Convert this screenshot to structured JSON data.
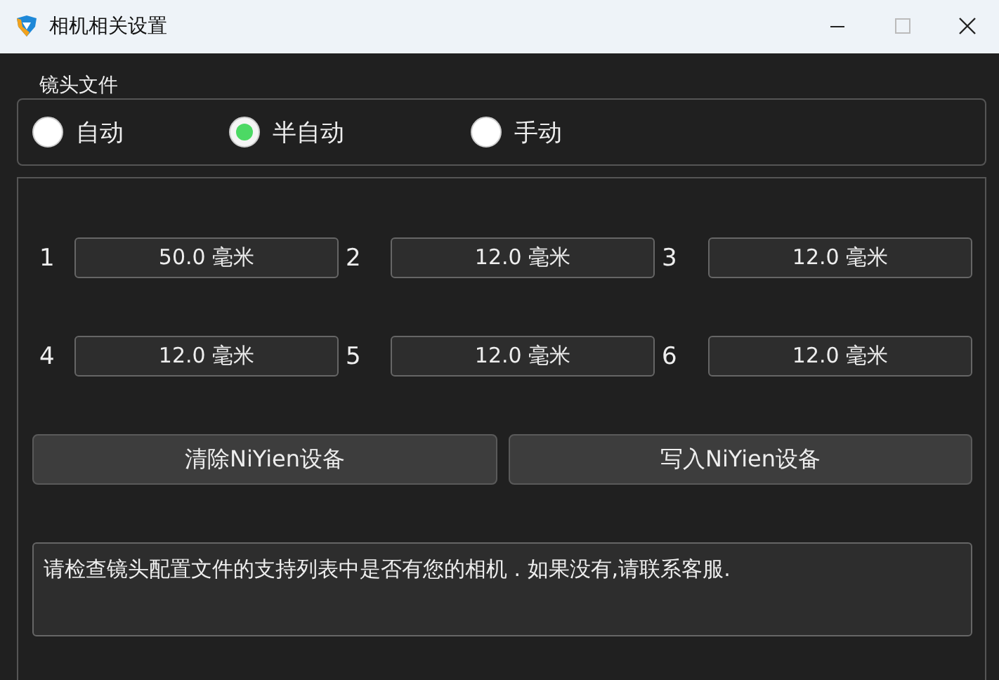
{
  "window": {
    "title": "相机相关设置"
  },
  "lens_file": {
    "legend": "镜头文件",
    "options": [
      {
        "label": "自动",
        "selected": false
      },
      {
        "label": "半自动",
        "selected": true
      },
      {
        "label": "手动",
        "selected": false
      }
    ]
  },
  "lenses": [
    {
      "index": "1",
      "value": "50.0 毫米"
    },
    {
      "index": "2",
      "value": "12.0 毫米"
    },
    {
      "index": "3",
      "value": "12.0 毫米"
    },
    {
      "index": "4",
      "value": "12.0 毫米"
    },
    {
      "index": "5",
      "value": "12.0 毫米"
    },
    {
      "index": "6",
      "value": "12.0 毫米"
    }
  ],
  "buttons": [
    "清除NiYien设备",
    "写入NiYien设备"
  ],
  "message": "请检查镜头配置文件的支持列表中是否有您的相机 . 如果没有,请联系客服."
}
